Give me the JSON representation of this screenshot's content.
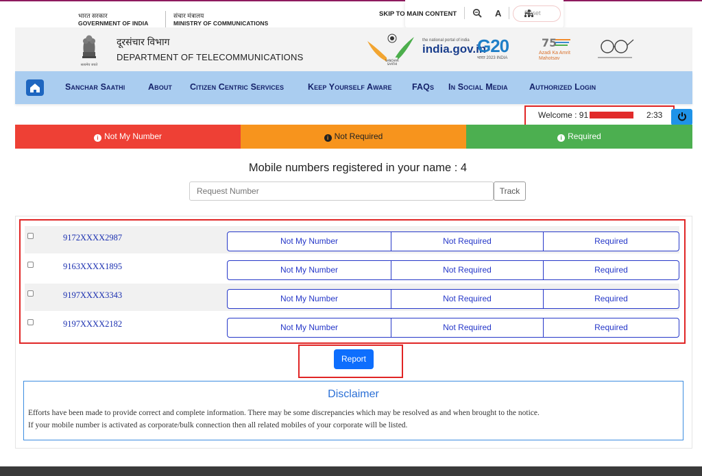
{
  "gov": {
    "hi1": "भारत सरकार",
    "en1": "GOVERNMENT OF INDIA",
    "hi2": "संचार मंत्रालय",
    "en2": "MINISTRY OF COMMUNICATIONS"
  },
  "accessibility": {
    "skip": "SKIP TO MAIN CONTENT",
    "reset": "Reset"
  },
  "dept": {
    "hi": "दूरसंचार विभाग",
    "en": "DEPARTMENT OF TELECOMMUNICATIONS"
  },
  "logos": {
    "india_gov": "india.gov.in",
    "india_tag": "the national portal of india",
    "g20": "G20",
    "g20_tag": "भारत 2023 INDIA",
    "azadi": "Azadi Ka Amrit Mahotsav"
  },
  "nav": {
    "items": [
      "Sanchar Saathi",
      "About",
      "Citizen Centric Services",
      "Keep Yourself Aware",
      "FAQs",
      "In Social Media",
      "Authorized Login"
    ]
  },
  "session": {
    "welcome": "Welcome : 91",
    "timer": "2:33"
  },
  "tabs": {
    "not_my_number": "Not My Number",
    "not_required": "Not Required",
    "required": "Required"
  },
  "heading": "Mobile numbers registered in your name : 4",
  "request": {
    "placeholder": "Request Number",
    "track": "Track"
  },
  "rows": [
    {
      "number": "9172XXXX2987"
    },
    {
      "number": "9163XXXX1895"
    },
    {
      "number": "9197XXXX3343"
    },
    {
      "number": "9197XXXX2182"
    }
  ],
  "row_actions": {
    "not_my_number": "Not My Number",
    "not_required": "Not Required",
    "required": "Required"
  },
  "report": "Report",
  "disclaimer": {
    "title": "Disclaimer",
    "line1": "Efforts have been made to provide correct and complete information. There may be some discrepancies which may be resolved as and when brought to the notice.",
    "line2": "If your mobile number is activated as corporate/bulk connection then all related mobiles of your corporate will be listed."
  }
}
